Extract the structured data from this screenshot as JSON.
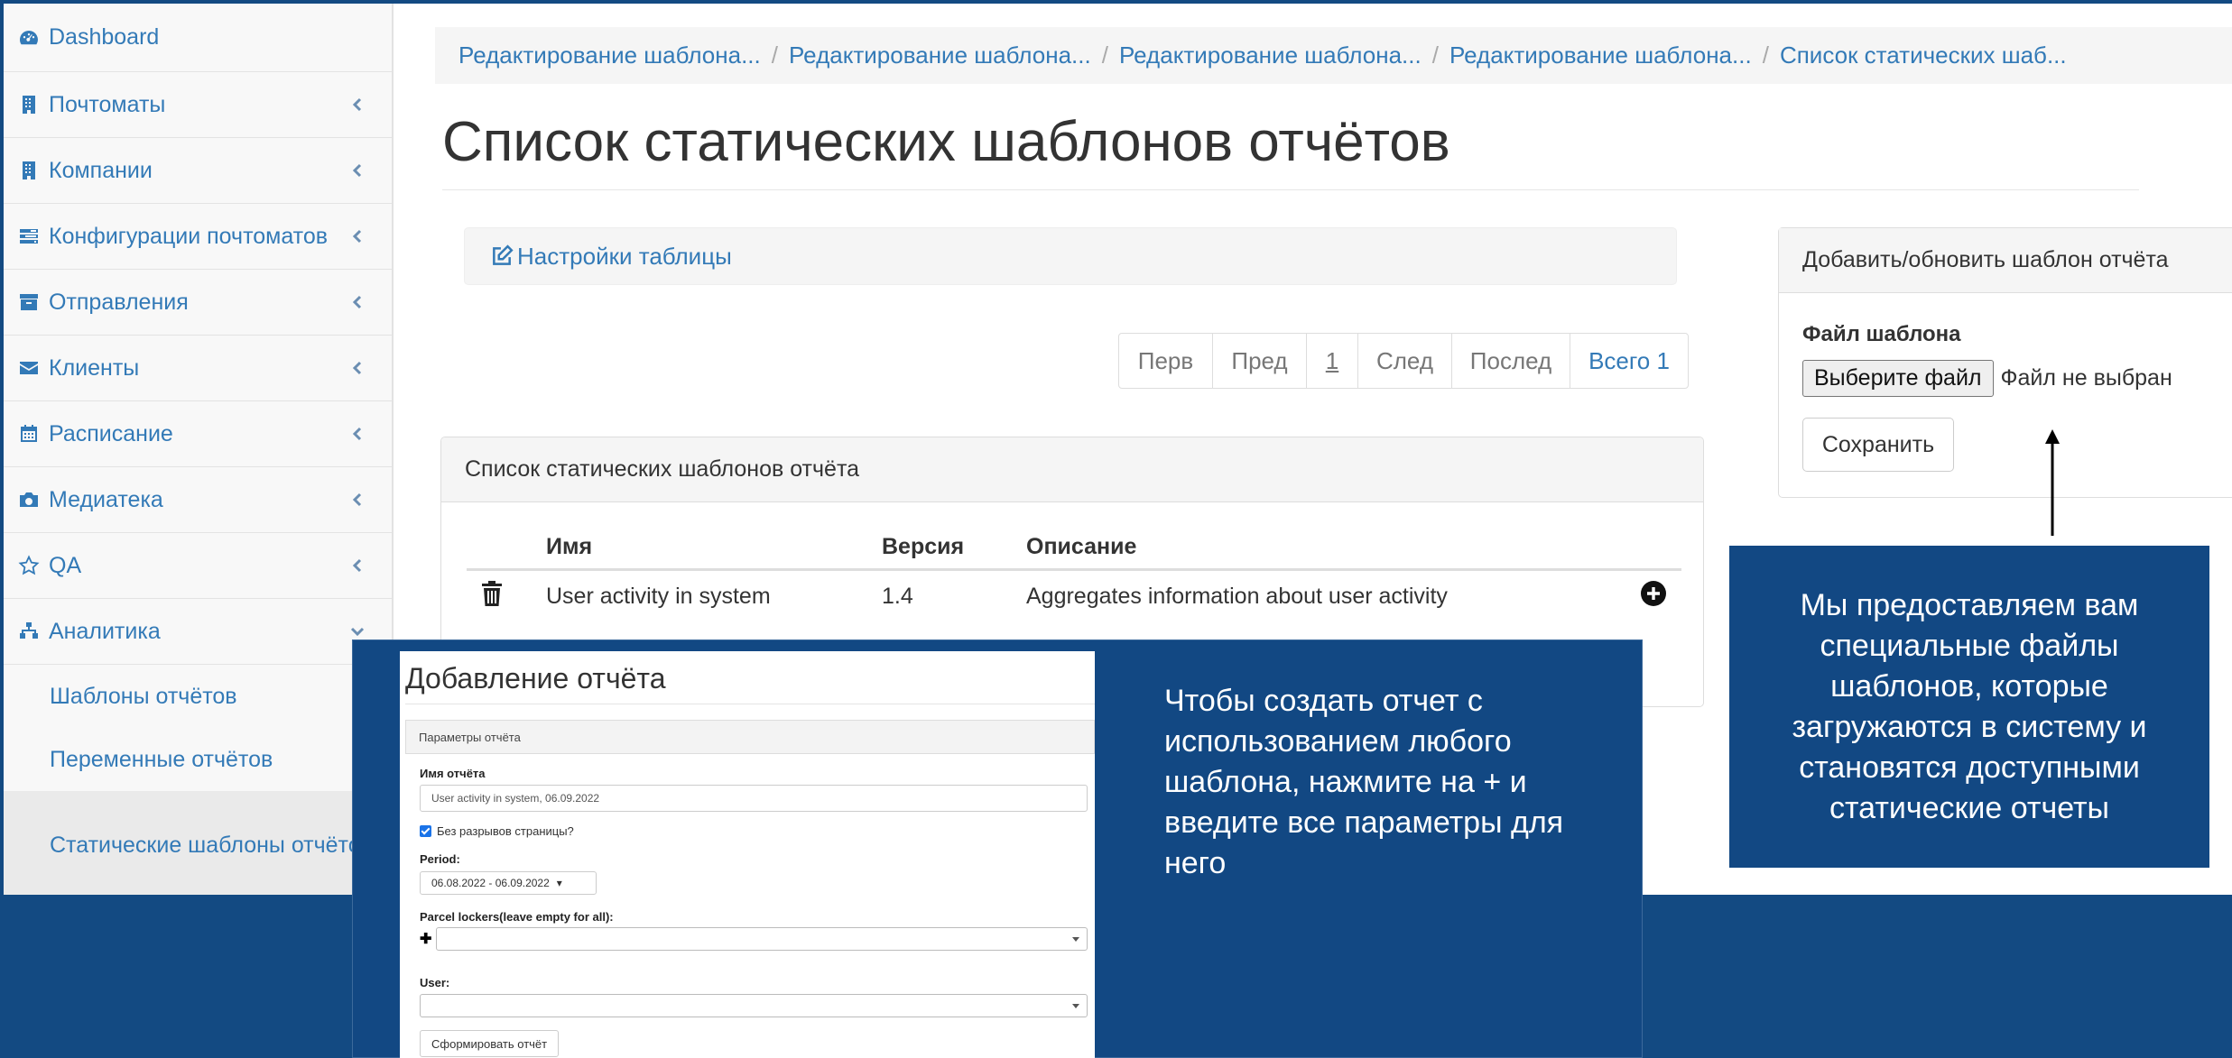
{
  "sidebar": {
    "items": [
      {
        "label": "Dashboard",
        "icon": "dashboard-icon"
      },
      {
        "label": "Почтоматы",
        "icon": "building-icon"
      },
      {
        "label": "Компании",
        "icon": "building-icon"
      },
      {
        "label": "Конфигурации почтоматов",
        "icon": "tasks-icon"
      },
      {
        "label": "Отправления",
        "icon": "archive-icon"
      },
      {
        "label": "Клиенты",
        "icon": "envelope-icon"
      },
      {
        "label": "Расписание",
        "icon": "calendar-icon"
      },
      {
        "label": "Медиатека",
        "icon": "camera-icon"
      },
      {
        "label": "QA",
        "icon": "star-icon"
      },
      {
        "label": "Аналитика",
        "icon": "sitemap-icon"
      }
    ],
    "subitems": [
      {
        "label": "Шаблоны отчётов"
      },
      {
        "label": "Переменные отчётов"
      },
      {
        "label": "Статические шаблоны отчётов"
      }
    ]
  },
  "breadcrumb": {
    "items": [
      "Редактирование шаблона...",
      "Редактирование шаблона...",
      "Редактирование шаблона...",
      "Редактирование шаблона...",
      "Список статических шаб..."
    ],
    "separator": "/"
  },
  "page": {
    "title": "Список статических шаблонов отчётов",
    "settings_label": "Настройки таблицы"
  },
  "pager": {
    "first": "Перв",
    "prev": "Пред",
    "current": "1",
    "next": "След",
    "last": "Послед",
    "total": "Всего 1"
  },
  "table": {
    "panel_title": "Список статических шаблонов отчёта",
    "columns": [
      "Имя",
      "Версия",
      "Описание"
    ],
    "rows": [
      {
        "name": "User activity in system",
        "version": "1.4",
        "description": "Aggregates information about user activity"
      }
    ]
  },
  "upload": {
    "panel_title": "Добавить/обновить шаблон отчёта",
    "file_label": "Файл шаблона",
    "choose_button": "Выберите файл",
    "no_file": "Файл не выбран",
    "save_button": "Сохранить"
  },
  "callouts": {
    "right": "Мы предоставляем вам специальные файлы шаблонов, которые загружаются в систему и становятся доступными статические отчеты",
    "bottom": "Чтобы создать отчет с использованием любого шаблона, нажмите на + и введите все параметры для него"
  },
  "report_form": {
    "title": "Добавление отчёта",
    "panel_title": "Параметры отчёта",
    "name_label": "Имя отчёта",
    "name_value": "User activity in system, 06.09.2022",
    "no_breaks_label": "Без разрывов страницы?",
    "period_label": "Period:",
    "period_value": "06.08.2022 - 06.09.2022",
    "lockers_label": "Parcel lockers(leave empty for all):",
    "user_label": "User:",
    "submit_button": "Сформировать отчёт"
  },
  "colors": {
    "background": "#134a82",
    "link": "#337ab7",
    "callout": "#124883"
  }
}
